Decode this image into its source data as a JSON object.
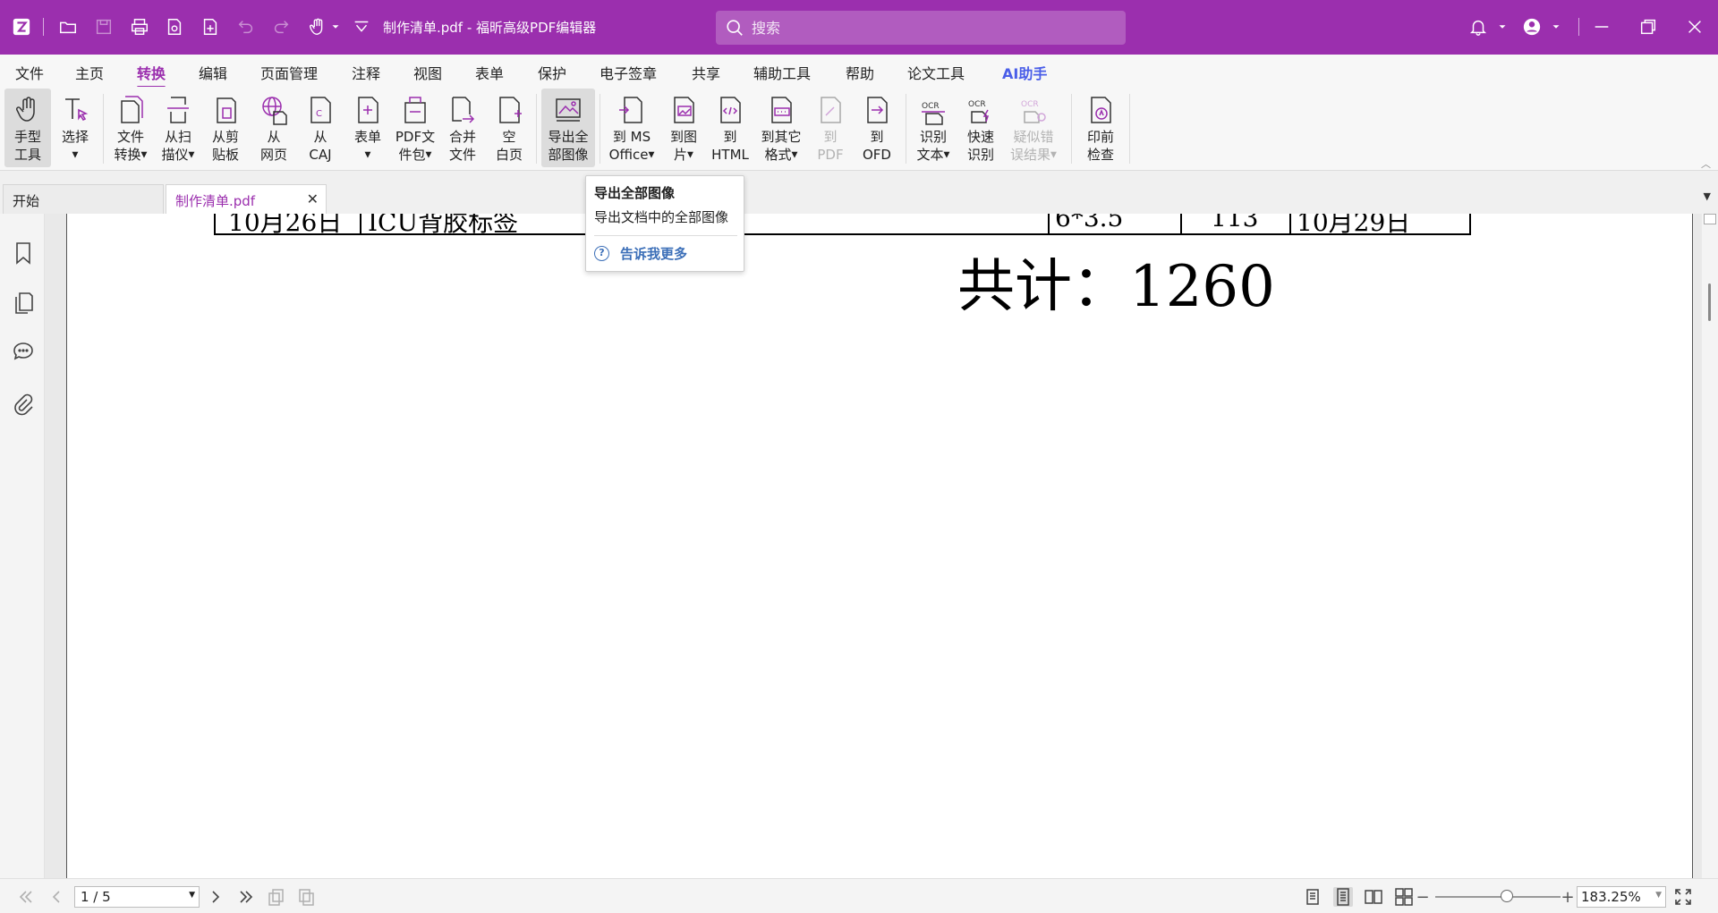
{
  "window": {
    "title": "制作清单.pdf - 福昕高级PDF编辑器",
    "accent_color": "#9b2fae"
  },
  "search": {
    "placeholder": "搜索"
  },
  "menu": {
    "items": [
      "文件",
      "主页",
      "转换",
      "编辑",
      "页面管理",
      "注释",
      "视图",
      "表单",
      "保护",
      "电子签章",
      "共享",
      "辅助工具",
      "帮助",
      "论文工具",
      "AI助手"
    ],
    "active": "转换"
  },
  "ribbon": {
    "hand_tool": "手型\n工具",
    "select": "选择",
    "file_convert": "文件\n转换",
    "from_scanner": "从扫\n描仪",
    "from_clipboard": "从剪\n贴板",
    "from_webpage": "从\n网页",
    "from_caj": "从\nCAJ",
    "form": "表单",
    "pdf_package": "PDF文\n件包",
    "merge_files": "合并\n文件",
    "blank_page": "空\n白页",
    "export_all_images": "导出全\n部图像",
    "to_ms_office": "到 MS\nOffice",
    "to_image": "到图\n片",
    "to_html": "到\nHTML",
    "to_other_formats": "到其它\n格式",
    "to_pdf": "到\nPDF",
    "to_ofd": "到\nOFD",
    "ocr_text": "识别\n文本",
    "quick_ocr": "快速\n识别",
    "suspect_errors": "疑似错\n误结果",
    "preflight": "印前\n检查"
  },
  "tabs": {
    "start": "开始",
    "file": "制作清单.pdf"
  },
  "tooltip": {
    "title": "导出全部图像",
    "description": "导出文档中的全部图像",
    "link": "告诉我更多"
  },
  "document": {
    "row": {
      "date_start": "10月26日",
      "item": "ICU背胶标签",
      "size": "6*3.5",
      "qty": "113",
      "date_end": "10月29日"
    },
    "total": "共计：1260"
  },
  "status": {
    "page": "1 / 5",
    "zoom": "183.25%",
    "zoom_level": 0.57
  }
}
